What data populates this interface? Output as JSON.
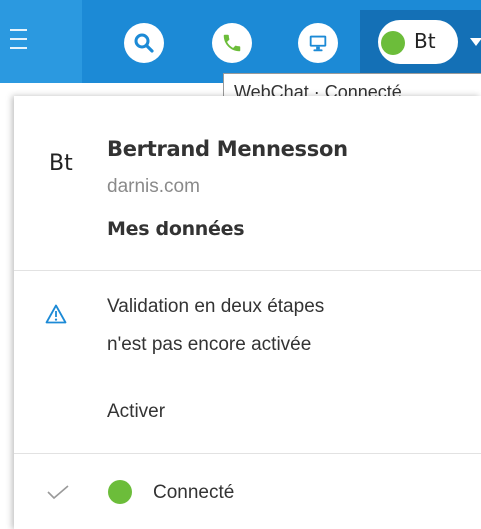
{
  "header": {
    "avatar_initials": "Bt",
    "tooltip": "WebChat · Connecté"
  },
  "colors": {
    "topbar": "#1c8ad6",
    "online_green": "#6cbd3a",
    "warning_blue": "#1c8ad6"
  },
  "icons": {
    "menu": "hamburger-icon",
    "search": "search-icon",
    "phone": "phone-icon",
    "screen": "monitor-icon",
    "caret": "chevron-down-icon",
    "warning": "warning-triangle-icon",
    "check": "check-icon"
  },
  "profile": {
    "initials": "Bt",
    "name": "Bertrand Mennesson",
    "domain": "darnis.com",
    "my_data_link": "Mes données"
  },
  "two_factor": {
    "line1": "Validation en deux étapes",
    "line2": "n'est pas encore activée",
    "activate_link": "Activer"
  },
  "status": {
    "label": "Connecté"
  }
}
